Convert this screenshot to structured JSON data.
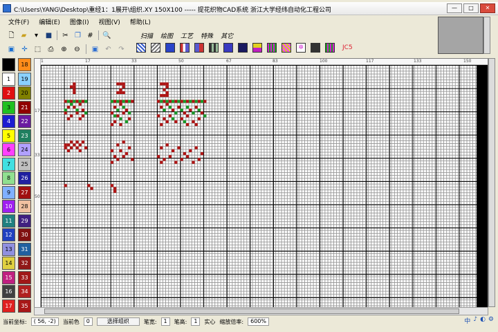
{
  "window": {
    "title": "C:\\Users\\YANG\\Desktop\\重经1：1展开\\组织.XY  150X100  -----  提花织物CAD系统  浙江大学经纬自动化工程公司",
    "buttons": {
      "minimize": "—",
      "maximize": "□",
      "close": "✕"
    }
  },
  "menu": [
    "文件(F)",
    "编辑(E)",
    "图像(I)",
    "视图(V)",
    "帮助(L)"
  ],
  "tabs": [
    "扫描",
    "绘图",
    "工艺",
    "特殊",
    "其它"
  ],
  "toolbar": {
    "row1_icons": [
      "new-file-icon",
      "open-folder-icon",
      "dropdown-icon",
      "save-icon",
      "cut-icon",
      "copy-icon",
      "grid-icon",
      "preview-icon"
    ],
    "row2_icons": [
      "view-icon",
      "crosshair-icon",
      "zoom-window-icon",
      "print-icon",
      "zoom-in-icon",
      "zoom-out-icon",
      "select-icon",
      "undo-icon",
      "redo-icon"
    ],
    "pattern_label": "JC5"
  },
  "palette": [
    {
      "label": "",
      "color": "#000000"
    },
    {
      "label": "18",
      "color": "#ff8c1a"
    },
    {
      "label": "1",
      "color": "#ffffff"
    },
    {
      "label": "19",
      "color": "#8ad0ff"
    },
    {
      "label": "2",
      "color": "#e01010"
    },
    {
      "label": "20",
      "color": "#808000"
    },
    {
      "label": "3",
      "color": "#20c020"
    },
    {
      "label": "21",
      "color": "#900000"
    },
    {
      "label": "4",
      "color": "#1c1cd0"
    },
    {
      "label": "22",
      "color": "#6a1aa0"
    },
    {
      "label": "5",
      "color": "#ffff00"
    },
    {
      "label": "23",
      "color": "#208060"
    },
    {
      "label": "6",
      "color": "#ff40ff"
    },
    {
      "label": "24",
      "color": "#b0a0ff"
    },
    {
      "label": "7",
      "color": "#40e0e0"
    },
    {
      "label": "25",
      "color": "#c0c0c0"
    },
    {
      "label": "8",
      "color": "#90e090"
    },
    {
      "label": "26",
      "color": "#2020a0"
    },
    {
      "label": "9",
      "color": "#80b0ff"
    },
    {
      "label": "27",
      "color": "#a01010"
    },
    {
      "label": "10",
      "color": "#a020f0"
    },
    {
      "label": "28",
      "color": "#f0c0a0"
    },
    {
      "label": "11",
      "color": "#208080"
    },
    {
      "label": "29",
      "color": "#402080"
    },
    {
      "label": "12",
      "color": "#2040c0"
    },
    {
      "label": "30",
      "color": "#801010"
    },
    {
      "label": "13",
      "color": "#9090e0"
    },
    {
      "label": "31",
      "color": "#2060a0"
    },
    {
      "label": "14",
      "color": "#e0d040"
    },
    {
      "label": "32",
      "color": "#901818"
    },
    {
      "label": "15",
      "color": "#c02080"
    },
    {
      "label": "33",
      "color": "#a01818"
    },
    {
      "label": "16",
      "color": "#404040"
    },
    {
      "label": "34",
      "color": "#b02020"
    },
    {
      "label": "17",
      "color": "#e02020"
    },
    {
      "label": "35",
      "color": "#a81818"
    }
  ],
  "ruler": {
    "top": [
      "1",
      "17",
      "33",
      "50",
      "67",
      "83",
      "100",
      "117",
      "133",
      "150"
    ],
    "left": [
      "17",
      "33",
      "50"
    ]
  },
  "status": {
    "coord_label": "当前坐标:",
    "coord_value": "(  56,    -2)",
    "color_label": "当前色",
    "color_value": "0",
    "mode_button": "选择组织",
    "pen_width_label": "笔宽:",
    "pen_width_value": "1",
    "pen_height_label": "笔高:",
    "pen_height_value": "1",
    "fill_label": "实心",
    "zoom_label": "缩放倍率:",
    "zoom_value": "600%"
  },
  "tray": [
    "中",
    "♪",
    "◐",
    "⚙"
  ],
  "colors": {
    "red": "#b01515",
    "green": "#1a9a2a",
    "window_bg": "#ece9d8"
  }
}
